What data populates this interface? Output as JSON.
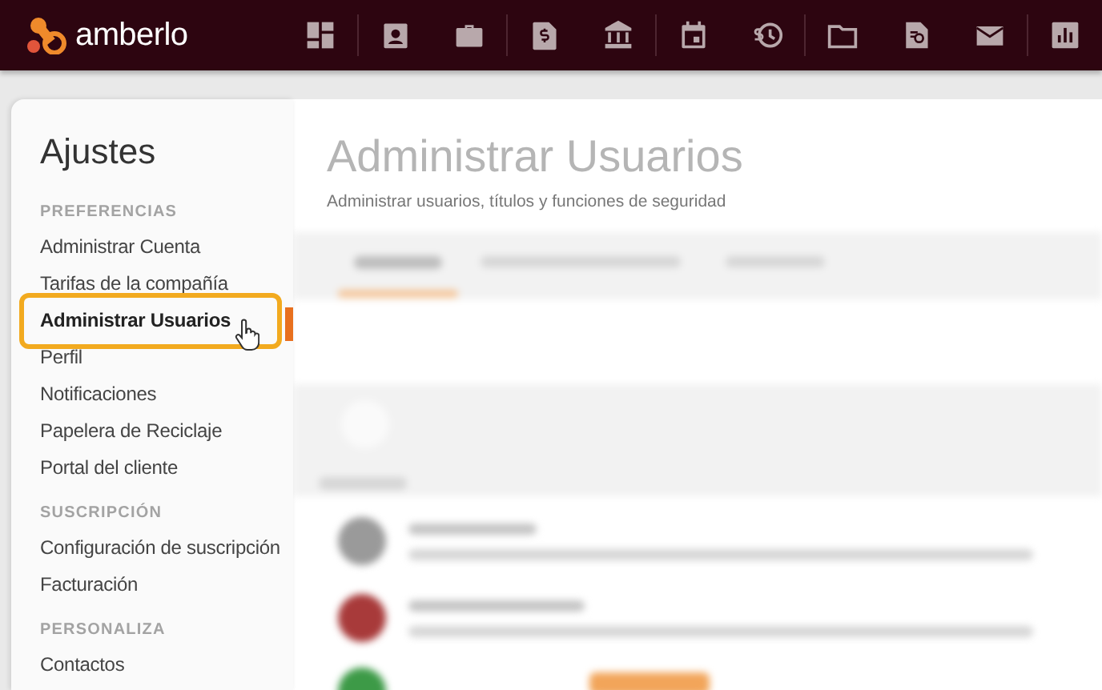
{
  "app_bar": {
    "logo_text": "amberlo"
  },
  "sidebar": {
    "title": "Ajustes",
    "sections": [
      {
        "heading": "PREFERENCIAS",
        "items": [
          {
            "label": "Administrar Cuenta",
            "selected": false
          },
          {
            "label": "Tarifas de la compañía",
            "selected": false
          },
          {
            "label": "Administrar Usuarios",
            "selected": true
          },
          {
            "label": "Perfil",
            "selected": false
          },
          {
            "label": "Notificaciones",
            "selected": false
          },
          {
            "label": "Papelera de Reciclaje",
            "selected": false
          },
          {
            "label": "Portal del cliente",
            "selected": false
          }
        ]
      },
      {
        "heading": "SUSCRIPCIÓN",
        "items": [
          {
            "label": "Configuración de suscripción",
            "selected": false
          },
          {
            "label": "Facturación",
            "selected": false
          }
        ]
      },
      {
        "heading": "PERSONALIZA",
        "items": [
          {
            "label": "Contactos",
            "selected": false
          }
        ]
      }
    ]
  },
  "main": {
    "title": "Administrar Usuarios",
    "subtitle": "Administrar usuarios, títulos y funciones de seguridad"
  }
}
